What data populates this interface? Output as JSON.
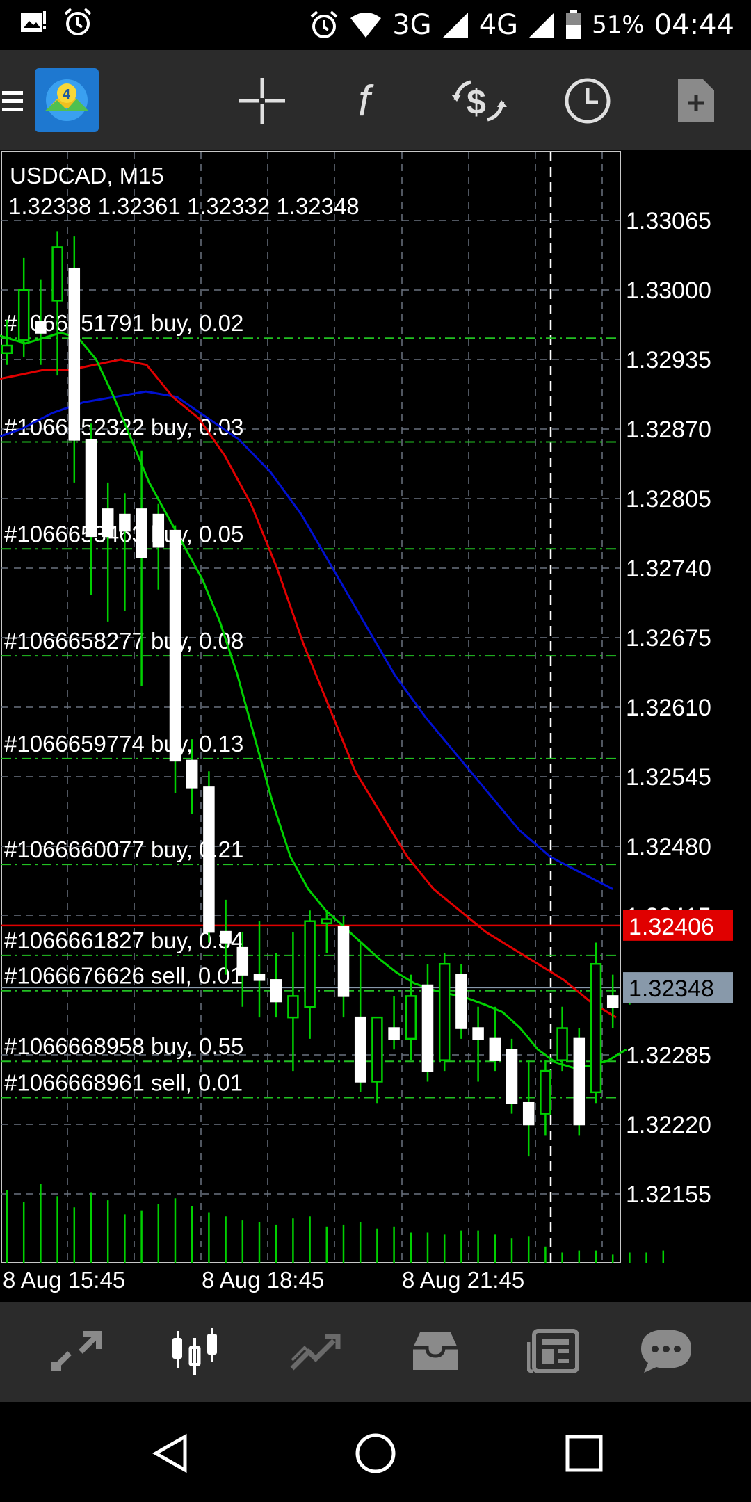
{
  "status_bar": {
    "icons_left": [
      "image-notification-icon",
      "alarm-icon"
    ],
    "icons_right": [
      "alarm-icon",
      "wifi-icon",
      "signal-icon",
      "battery-icon"
    ],
    "network_3g": "3G",
    "network_4g": "4G",
    "battery": "51%",
    "time": "04:44"
  },
  "toolbar": {
    "icons": [
      "metatrader-logo",
      "crosshair-icon",
      "function-icon",
      "currency-exchange-icon",
      "clock-icon",
      "new-order-icon"
    ]
  },
  "chart": {
    "symbol_title": "USDCAD, M15",
    "ohlc": "1.32338 1.32361 1.32332 1.32348",
    "bid_price_label": "1.32406",
    "current_price_label": "1.32348",
    "price_axis": [
      "1.33065",
      "1.33000",
      "1.32935",
      "1.32870",
      "1.32805",
      "1.32740",
      "1.32675",
      "1.32610",
      "1.32545",
      "1.32480",
      "1.32415",
      "1.32285",
      "1.32220",
      "1.32155"
    ],
    "time_axis": [
      "8 Aug 15:45",
      "8 Aug 18:45",
      "8 Aug 21:45"
    ],
    "orders": [
      {
        "label": "#1066651791 buy, 0.02",
        "price": 1.32955
      },
      {
        "label": "#1066652322 buy, 0.03",
        "price": 1.32858
      },
      {
        "label": "#1066653463 buy, 0.05",
        "price": 1.32758
      },
      {
        "label": "#1066658277 buy, 0.08",
        "price": 1.32658
      },
      {
        "label": "#1066659774 buy, 0.13",
        "price": 1.32562
      },
      {
        "label": "#1066660077 buy, 0.21",
        "price": 1.32463
      },
      {
        "label": "#1066661827 buy, 0.34",
        "price": 1.32378
      },
      {
        "label": "#1066676626 sell, 0.01",
        "price": 1.32345
      },
      {
        "label": "#1066668958 buy, 0.55",
        "price": 1.32279
      },
      {
        "label": "#1066668961 sell, 0.01",
        "price": 1.32245
      }
    ],
    "colors": {
      "bid_line": "#e00000",
      "ask_line": "#8899aa",
      "candle": "#ffffff",
      "order_line": "#22c022",
      "ma_fast": "#00d000",
      "ma_mid": "#e00000",
      "ma_slow": "#0010d0",
      "volume": "#00d000",
      "grid": "#6a7380"
    }
  },
  "chart_data": {
    "type": "candlestick",
    "symbol": "USDCAD",
    "timeframe": "M15",
    "ylim": [
      1.321,
      1.3311
    ],
    "candles": [
      {
        "o": 1.32941,
        "h": 1.32972,
        "l": 1.3293,
        "c": 1.32948
      },
      {
        "o": 1.32953,
        "h": 1.3303,
        "l": 1.32937,
        "c": 1.33
      },
      {
        "o": 1.3297,
        "h": 1.3301,
        "l": 1.3293,
        "c": 1.3296
      },
      {
        "o": 1.3299,
        "h": 1.33055,
        "l": 1.3292,
        "c": 1.3304
      },
      {
        "o": 1.3302,
        "h": 1.3305,
        "l": 1.3282,
        "c": 1.3286
      },
      {
        "o": 1.3286,
        "h": 1.32875,
        "l": 1.32715,
        "c": 1.3277
      },
      {
        "o": 1.32795,
        "h": 1.3282,
        "l": 1.3269,
        "c": 1.3277
      },
      {
        "o": 1.3279,
        "h": 1.3281,
        "l": 1.327,
        "c": 1.32775
      },
      {
        "o": 1.32795,
        "h": 1.3285,
        "l": 1.3263,
        "c": 1.3275
      },
      {
        "o": 1.3279,
        "h": 1.328,
        "l": 1.3272,
        "c": 1.3276
      },
      {
        "o": 1.32775,
        "h": 1.3278,
        "l": 1.3253,
        "c": 1.3256
      },
      {
        "o": 1.3256,
        "h": 1.3258,
        "l": 1.3251,
        "c": 1.32535
      },
      {
        "o": 1.32535,
        "h": 1.3255,
        "l": 1.3239,
        "c": 1.324
      },
      {
        "o": 1.324,
        "h": 1.3243,
        "l": 1.3236,
        "c": 1.3239
      },
      {
        "o": 1.32385,
        "h": 1.324,
        "l": 1.3233,
        "c": 1.3236
      },
      {
        "o": 1.3236,
        "h": 1.3241,
        "l": 1.3232,
        "c": 1.32355
      },
      {
        "o": 1.32355,
        "h": 1.3238,
        "l": 1.3232,
        "c": 1.32335
      },
      {
        "o": 1.3232,
        "h": 1.324,
        "l": 1.3227,
        "c": 1.3234
      },
      {
        "o": 1.3233,
        "h": 1.3242,
        "l": 1.323,
        "c": 1.3241
      },
      {
        "o": 1.32408,
        "h": 1.3242,
        "l": 1.3238,
        "c": 1.32412
      },
      {
        "o": 1.32405,
        "h": 1.32415,
        "l": 1.3232,
        "c": 1.3234
      },
      {
        "o": 1.3232,
        "h": 1.3239,
        "l": 1.3225,
        "c": 1.3226
      },
      {
        "o": 1.3226,
        "h": 1.3232,
        "l": 1.3224,
        "c": 1.3232
      },
      {
        "o": 1.3231,
        "h": 1.3234,
        "l": 1.3229,
        "c": 1.323
      },
      {
        "o": 1.323,
        "h": 1.3236,
        "l": 1.3228,
        "c": 1.3234
      },
      {
        "o": 1.3235,
        "h": 1.3237,
        "l": 1.3226,
        "c": 1.3227
      },
      {
        "o": 1.3228,
        "h": 1.3238,
        "l": 1.3227,
        "c": 1.3237
      },
      {
        "o": 1.3236,
        "h": 1.3237,
        "l": 1.323,
        "c": 1.3231
      },
      {
        "o": 1.3231,
        "h": 1.3233,
        "l": 1.3226,
        "c": 1.323
      },
      {
        "o": 1.323,
        "h": 1.3233,
        "l": 1.3227,
        "c": 1.3228
      },
      {
        "o": 1.3229,
        "h": 1.323,
        "l": 1.3223,
        "c": 1.3224
      },
      {
        "o": 1.3224,
        "h": 1.3228,
        "l": 1.3219,
        "c": 1.3222
      },
      {
        "o": 1.3223,
        "h": 1.3228,
        "l": 1.3221,
        "c": 1.3227
      },
      {
        "o": 1.3228,
        "h": 1.3233,
        "l": 1.3227,
        "c": 1.3231
      },
      {
        "o": 1.323,
        "h": 1.3231,
        "l": 1.3221,
        "c": 1.3222
      },
      {
        "o": 1.3225,
        "h": 1.3239,
        "l": 1.3224,
        "c": 1.3237
      },
      {
        "o": 1.3234,
        "h": 1.3236,
        "l": 1.3231,
        "c": 1.3233
      },
      {
        "o": 1.32338,
        "h": 1.32361,
        "l": 1.32332,
        "c": 1.32348
      }
    ],
    "ma_fast": [
      1.3296,
      1.32955,
      1.3295,
      1.32955,
      1.3296,
      1.32955,
      1.32935,
      1.329,
      1.3286,
      1.3282,
      1.3279,
      1.3276,
      1.3273,
      1.3269,
      1.3264,
      1.3258,
      1.3252,
      1.3247,
      1.3244,
      1.3242,
      1.32405,
      1.3239,
      1.32375,
      1.32362,
      1.32352,
      1.32346,
      1.32342,
      1.32338,
      1.32332,
      1.32325,
      1.3231,
      1.3229,
      1.32278,
      1.32273,
      1.32275,
      1.3228,
      1.3229
    ],
    "ma_mid": [
      1.32915,
      1.3292,
      1.32925,
      1.32925,
      1.3293,
      1.32935,
      1.3293,
      1.329,
      1.3288,
      1.32845,
      1.328,
      1.3274,
      1.3267,
      1.3261,
      1.3255,
      1.3251,
      1.3247,
      1.3244,
      1.3242,
      1.324,
      1.32385,
      1.3237,
      1.32355,
      1.32335,
      1.3232
    ],
    "ma_slow": [
      1.3286,
      1.3287,
      1.32885,
      1.32895,
      1.329,
      1.32905,
      1.329,
      1.3288,
      1.3286,
      1.3283,
      1.3279,
      1.3274,
      1.3269,
      1.3264,
      1.326,
      1.32565,
      1.3253,
      1.32495,
      1.3247,
      1.32455,
      1.3244
    ],
    "volume": [
      72,
      60,
      78,
      66,
      55,
      70,
      62,
      48,
      52,
      58,
      64,
      56,
      50,
      46,
      42,
      40,
      38,
      44,
      46,
      36,
      38,
      40,
      34,
      36,
      30,
      30,
      28,
      32,
      32,
      28,
      24,
      26,
      16,
      10,
      12,
      12,
      8,
      10,
      10,
      12
    ]
  },
  "bottom_nav": {
    "items": [
      "quotes-icon",
      "chart-icon",
      "trade-icon",
      "history-icon",
      "news-icon",
      "chat-icon"
    ],
    "active": "chart-icon"
  },
  "system_nav": [
    "back-icon",
    "home-icon",
    "recents-icon"
  ]
}
